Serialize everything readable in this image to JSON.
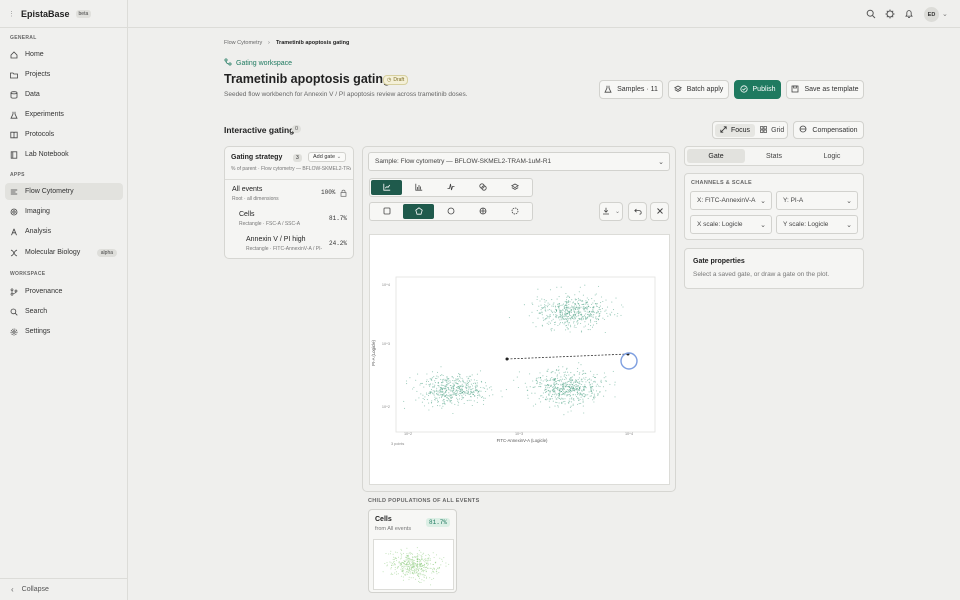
{
  "app": {
    "brand": "EpistaBase",
    "brand_badge": "beta"
  },
  "sidebar": {
    "sections": [
      {
        "label": "GENERAL"
      },
      {
        "label": "APPS"
      },
      {
        "label": "WORKSPACE"
      }
    ],
    "items": [
      {
        "label": "Home",
        "icon": "home-icon"
      },
      {
        "label": "Projects",
        "icon": "folder-icon"
      },
      {
        "label": "Data",
        "icon": "database-icon"
      },
      {
        "label": "Experiments",
        "icon": "flask-icon"
      },
      {
        "label": "Protocols",
        "icon": "book-icon"
      },
      {
        "label": "Lab Notebook",
        "icon": "notebook-icon"
      },
      {
        "label": "Flow Cytometry",
        "icon": "flow-icon",
        "active": true
      },
      {
        "label": "Imaging",
        "icon": "image-icon"
      },
      {
        "label": "Analysis",
        "icon": "chart-icon"
      },
      {
        "label": "Molecular Biology",
        "icon": "dna-icon",
        "badge": "alpha"
      },
      {
        "label": "Provenance",
        "icon": "branch-icon"
      },
      {
        "label": "Search",
        "icon": "search-icon"
      },
      {
        "label": "Settings",
        "icon": "gear-icon"
      }
    ],
    "collapse_label": "Collapse"
  },
  "topbar": {
    "avatar_initials": "ED"
  },
  "breadcrumb": {
    "parent": "Flow Cytometry",
    "separator": "›",
    "current": "Trametinib apoptosis gating"
  },
  "header": {
    "workspace_link": "Gating workspace",
    "title": "Trametinib apoptosis gating",
    "status": "Draft",
    "subtitle": "Seeded flow workbench for Annexin V / PI apoptosis review across trametinib doses.",
    "buttons": {
      "samples": "Samples · 11",
      "batch": "Batch apply",
      "publish": "Publish",
      "template": "Save as template"
    }
  },
  "gating": {
    "title": "Interactive gating",
    "count": "0",
    "views": {
      "focus": "Focus",
      "grid": "Grid",
      "compensation": "Compensation"
    }
  },
  "strategy": {
    "title": "Gating strategy",
    "count": "3",
    "add_gate": "Add gate",
    "subtitle": "% of parent · Flow cytometry — BFLOW-SKMEL2-TRAM-1uM-R1",
    "nodes": [
      {
        "name": "All events",
        "meta": "Root · all dimensions",
        "pct": "100%"
      },
      {
        "name": "Cells",
        "meta": "Rectangle · FSC-A / SSC-A",
        "pct": "81.7%"
      },
      {
        "name": "Annexin V / PI high",
        "meta": "Rectangle · FITC-AnnexinV-A / PI-A",
        "pct": "24.2%"
      }
    ]
  },
  "plot_panel": {
    "sample_select": "Sample: Flow cytometry — BFLOW-SKMEL2-TRAM-1uM-R1",
    "x_axis_label": "FITC-AnnexinV-A (Logicle)",
    "y_axis_label": "PI-A (Logicle)",
    "x_ticks": [
      "10^2",
      "10^3",
      "10^4"
    ],
    "y_ticks": [
      "10^2",
      "10^3",
      "10^4"
    ],
    "corner_note": "3 points",
    "child_header": "CHILD POPULATIONS OF ALL EVENTS",
    "child_card": {
      "name": "Cells",
      "sub": "from All events",
      "pct": "81.7%"
    }
  },
  "right_panel": {
    "tabs": [
      "Gate",
      "Stats",
      "Logic"
    ],
    "channels_label": "CHANNELS & SCALE",
    "x_channel": "X: FITC-AnnexinV-A",
    "y_channel": "Y: PI-A",
    "x_scale": "X scale: Logicle",
    "y_scale": "Y scale: Logicle",
    "gate_props_title": "Gate properties",
    "gate_props_text": "Select a saved gate, or draw a gate on the plot."
  },
  "colors": {
    "accent": "#1f7a60",
    "dots": "#3f9a7c"
  }
}
